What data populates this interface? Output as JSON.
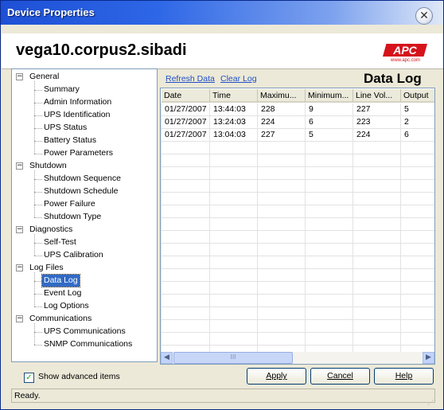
{
  "window": {
    "title": "Device Properties"
  },
  "header": {
    "host": "vega10.corpus2.sibadi",
    "logo_text": "APC",
    "logo_sub": "www.apc.com"
  },
  "tree": [
    {
      "label": "General",
      "level": 0,
      "expander": "-"
    },
    {
      "label": "Summary",
      "level": 1
    },
    {
      "label": "Admin Information",
      "level": 1
    },
    {
      "label": "UPS Identification",
      "level": 1
    },
    {
      "label": "UPS Status",
      "level": 1
    },
    {
      "label": "Battery Status",
      "level": 1
    },
    {
      "label": "Power Parameters",
      "level": 1
    },
    {
      "label": "Shutdown",
      "level": 0,
      "expander": "-"
    },
    {
      "label": "Shutdown Sequence",
      "level": 1
    },
    {
      "label": "Shutdown Schedule",
      "level": 1
    },
    {
      "label": "Power Failure",
      "level": 1
    },
    {
      "label": "Shutdown Type",
      "level": 1
    },
    {
      "label": "Diagnostics",
      "level": 0,
      "expander": "-"
    },
    {
      "label": "Self-Test",
      "level": 1
    },
    {
      "label": "UPS Calibration",
      "level": 1
    },
    {
      "label": "Log Files",
      "level": 0,
      "expander": "-"
    },
    {
      "label": "Data Log",
      "level": 1,
      "selected": true
    },
    {
      "label": "Event Log",
      "level": 1
    },
    {
      "label": "Log Options",
      "level": 1
    },
    {
      "label": "Communications",
      "level": 0,
      "expander": "-"
    },
    {
      "label": "UPS Communications",
      "level": 1
    },
    {
      "label": "SNMP Communications",
      "level": 1
    }
  ],
  "panel": {
    "refresh_link": "Refresh Data",
    "clear_link": "Clear Log",
    "title": "Data Log",
    "columns": [
      "Date",
      "Time",
      "Maximu...",
      "Minimum...",
      "Line Vol...",
      "Output"
    ],
    "rows": [
      [
        "01/27/2007",
        "13:44:03",
        "228",
        "9",
        "227",
        "5"
      ],
      [
        "01/27/2007",
        "13:24:03",
        "224",
        "6",
        "223",
        "2"
      ],
      [
        "01/27/2007",
        "13:04:03",
        "227",
        "5",
        "224",
        "6"
      ]
    ],
    "scroll_grip": "III"
  },
  "footer": {
    "show_advanced_label": "Show advanced items",
    "show_advanced_checked": true,
    "buttons": {
      "apply": "Apply",
      "cancel": "Cancel",
      "help": "Help"
    }
  },
  "status": {
    "text": "Ready."
  }
}
